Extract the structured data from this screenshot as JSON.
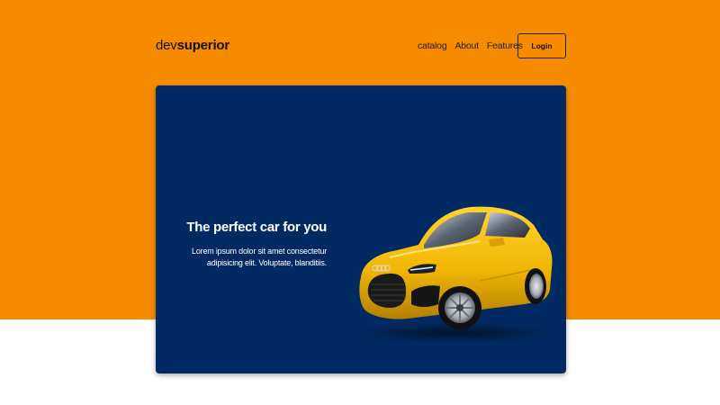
{
  "header": {
    "logo_light": "dev",
    "logo_bold": "superior",
    "nav": [
      "catalog",
      "About",
      "Features"
    ],
    "login_label": "Login"
  },
  "hero": {
    "title": "The perfect car for you",
    "subtitle": "Lorem ipsum dolor sit amet consectetur adipisicing elit. Voluptate, blanditiis."
  },
  "colors": {
    "accent_orange": "#f68b00",
    "card_navy": "#012a62",
    "car_yellow": "#f2b705"
  },
  "icons": {
    "car_image": "yellow-sports-car"
  }
}
